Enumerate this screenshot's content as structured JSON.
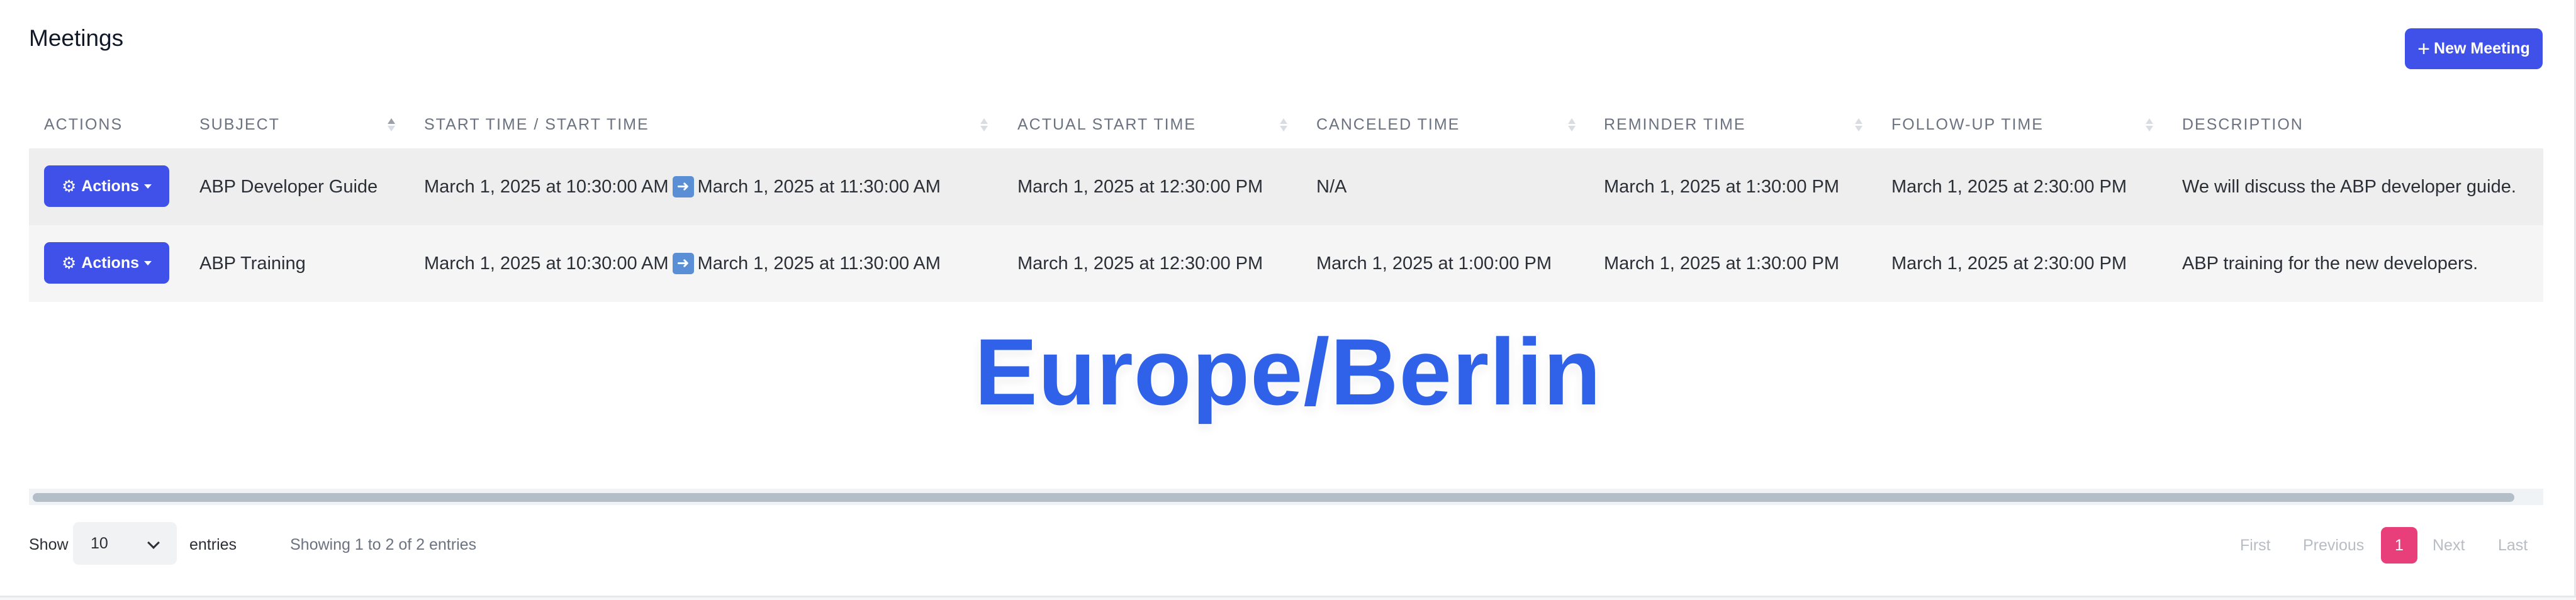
{
  "page": {
    "title": "Meetings",
    "new_button": {
      "icon": "+",
      "label": "New Meeting"
    }
  },
  "colors": {
    "primary": "#3f51e8",
    "active_page": "#e83e79",
    "watermark": "#2f62e9"
  },
  "table": {
    "columns": [
      {
        "label": "ACTIONS",
        "sortable": false
      },
      {
        "label": "SUBJECT",
        "sortable": true,
        "sort": "asc"
      },
      {
        "label": "START TIME / START TIME",
        "sortable": true
      },
      {
        "label": "ACTUAL START TIME",
        "sortable": true
      },
      {
        "label": "CANCELED TIME",
        "sortable": true
      },
      {
        "label": "REMINDER TIME",
        "sortable": true
      },
      {
        "label": "FOLLOW-UP TIME",
        "sortable": true
      },
      {
        "label": "DESCRIPTION",
        "sortable": false
      }
    ],
    "rows": [
      {
        "actions_label": "Actions",
        "subject": "ABP Developer Guide",
        "start_time_from": "March 1, 2025 at 10:30:00 AM",
        "start_time_to": "March 1, 2025 at 11:30:00 AM",
        "actual_start_time": "March 1, 2025 at 12:30:00 PM",
        "canceled_time": "N/A",
        "reminder_time": "March 1, 2025 at 1:30:00 PM",
        "follow_up_time": "March 1, 2025 at 2:30:00 PM",
        "description": "We will discuss the ABP developer guide."
      },
      {
        "actions_label": "Actions",
        "subject": "ABP Training",
        "start_time_from": "March 1, 2025 at 10:30:00 AM",
        "start_time_to": "March 1, 2025 at 11:30:00 AM",
        "actual_start_time": "March 1, 2025 at 12:30:00 PM",
        "canceled_time": "March 1, 2025 at 1:00:00 PM",
        "reminder_time": "March 1, 2025 at 1:30:00 PM",
        "follow_up_time": "March 1, 2025 at 2:30:00 PM",
        "description": "ABP training for the new developers."
      }
    ]
  },
  "overlay": {
    "timezone": "Europe/Berlin"
  },
  "footer": {
    "show_label": "Show",
    "page_size": "10",
    "entries_label": "entries",
    "info": "Showing 1 to 2 of 2 entries",
    "pagination": {
      "first": "First",
      "previous": "Previous",
      "current": "1",
      "next": "Next",
      "last": "Last"
    }
  }
}
